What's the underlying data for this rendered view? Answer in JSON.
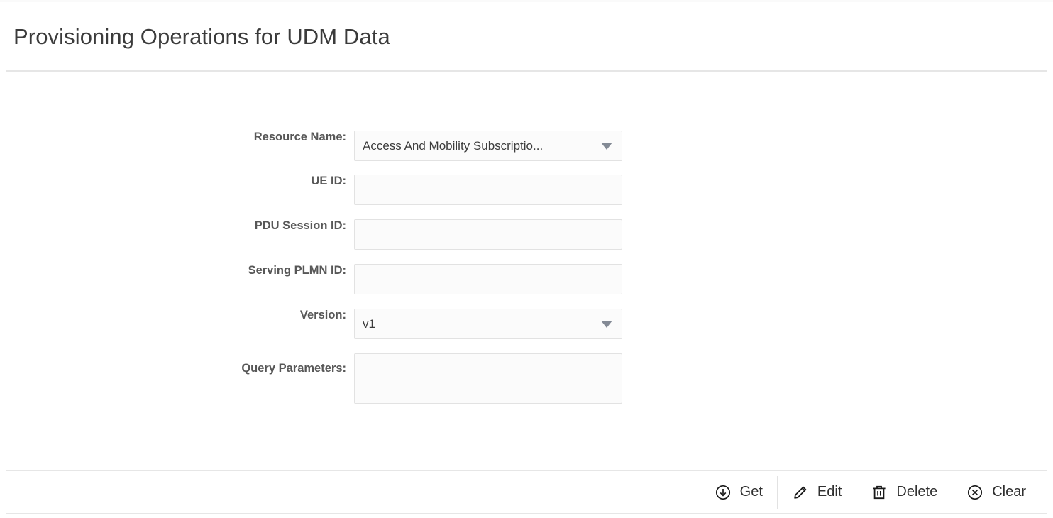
{
  "header": {
    "title": "Provisioning Operations for UDM Data"
  },
  "form": {
    "fields": [
      {
        "id": "resource-name",
        "label": "Resource Name:",
        "type": "select",
        "value": "Access And Mobility Subscriptio...",
        "icon": "chevron-down-icon"
      },
      {
        "id": "ue-id",
        "label": "UE ID:",
        "type": "text",
        "value": "",
        "placeholder": ""
      },
      {
        "id": "pdu-session-id",
        "label": "PDU Session ID:",
        "type": "text",
        "value": "",
        "placeholder": ""
      },
      {
        "id": "serving-plmn-id",
        "label": "Serving PLMN ID:",
        "type": "text",
        "value": "",
        "placeholder": ""
      },
      {
        "id": "version",
        "label": "Version:",
        "type": "select",
        "value": "v1",
        "icon": "chevron-down-icon"
      },
      {
        "id": "query-parameters",
        "label": "Query Parameters:",
        "type": "textarea",
        "value": "",
        "placeholder": ""
      }
    ]
  },
  "actions": {
    "buttons": [
      {
        "id": "get",
        "label": "Get",
        "icon": "download-circle-icon"
      },
      {
        "id": "edit",
        "label": "Edit",
        "icon": "pencil-icon"
      },
      {
        "id": "delete",
        "label": "Delete",
        "icon": "trash-icon"
      },
      {
        "id": "clear",
        "label": "Clear",
        "icon": "close-circle-icon"
      }
    ]
  },
  "colors": {
    "page_background": "#ffffff",
    "title_text": "#3b3b3b",
    "label_text": "#575757",
    "field_background": "#fbfbfb",
    "field_border": "#e2e2e2",
    "divider": "#e6e6e6",
    "arrow": "#838a95",
    "action_text": "#303030"
  }
}
